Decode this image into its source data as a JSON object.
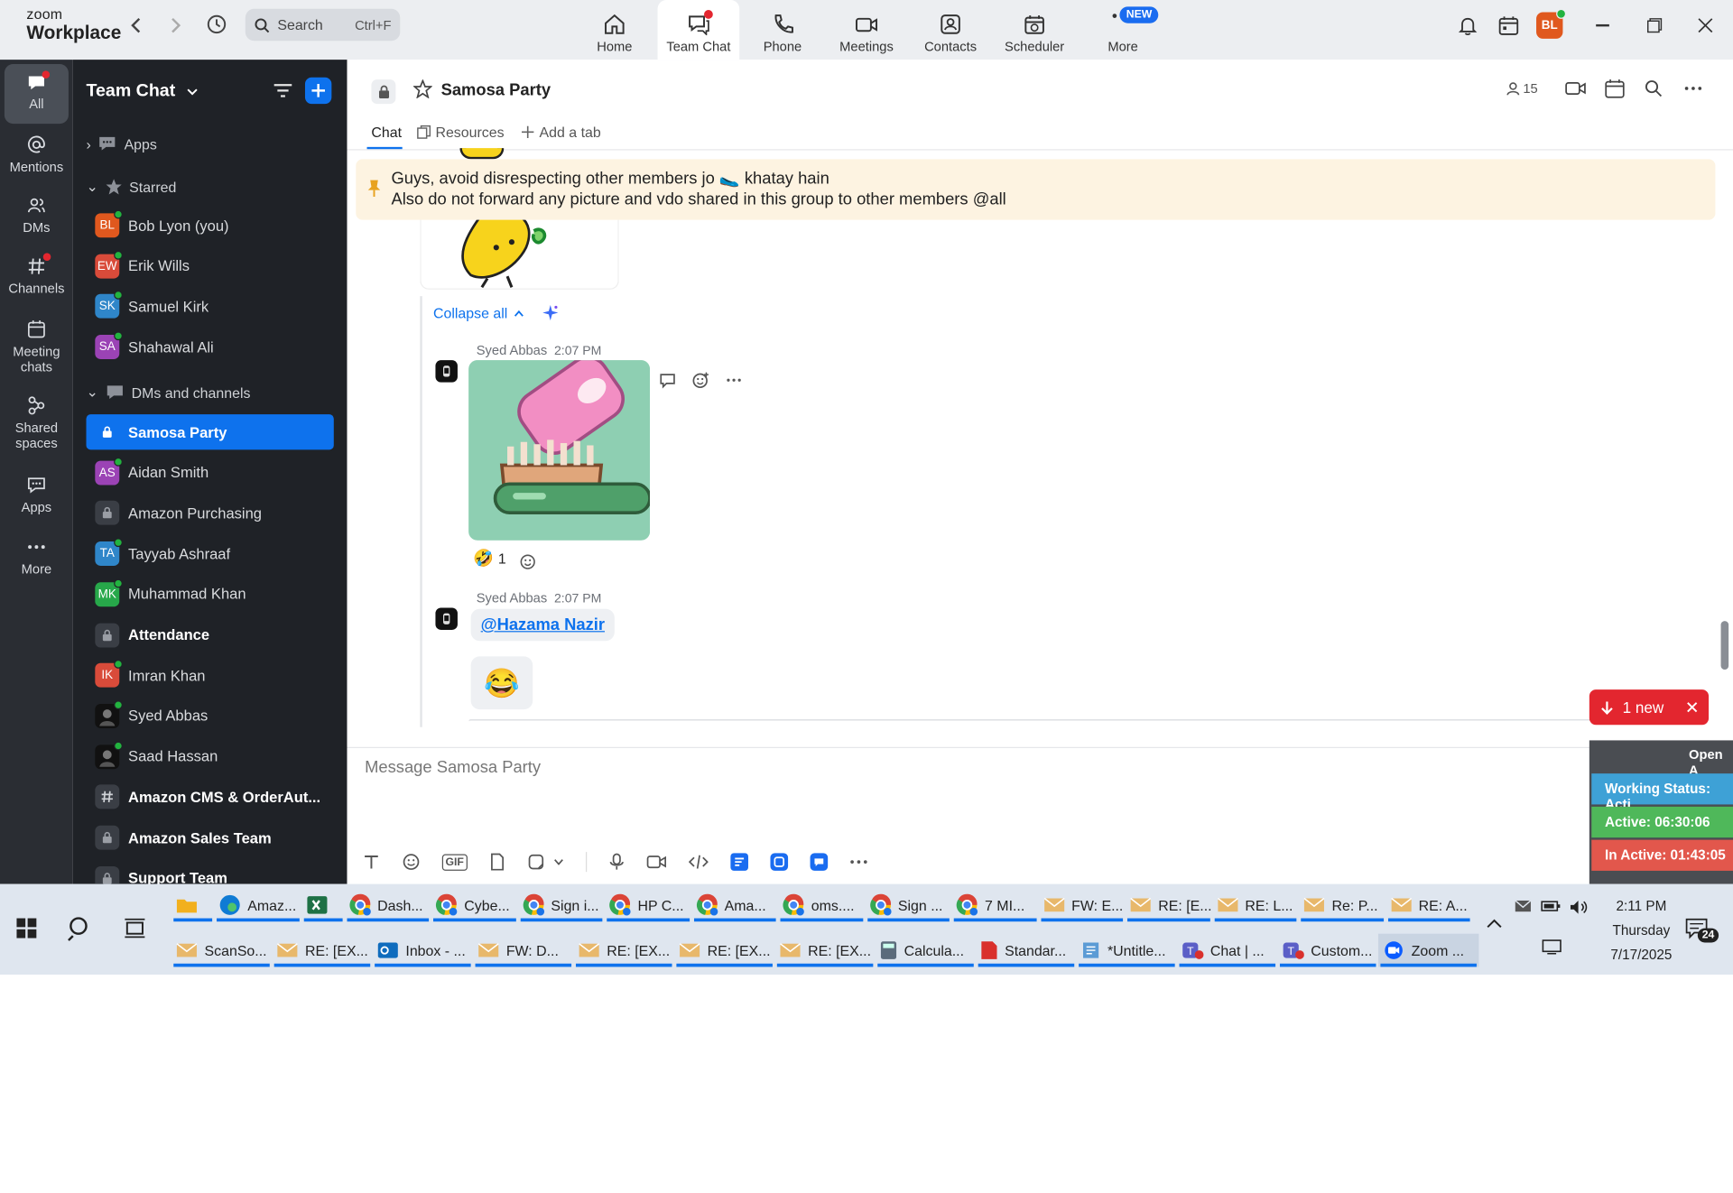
{
  "brand": {
    "line1": "zoom",
    "line2": "Workplace"
  },
  "search": {
    "placeholder": "Search",
    "shortcut": "Ctrl+F"
  },
  "top_nav": [
    {
      "label": "Home",
      "icon": "home-icon"
    },
    {
      "label": "Team Chat",
      "icon": "team-chat-icon",
      "active": true,
      "notification_dot": true
    },
    {
      "label": "Phone",
      "icon": "phone-icon"
    },
    {
      "label": "Meetings",
      "icon": "video-icon"
    },
    {
      "label": "Contacts",
      "icon": "contacts-icon"
    },
    {
      "label": "Scheduler",
      "icon": "scheduler-icon"
    },
    {
      "label": "More",
      "icon": "more-icon",
      "badge": "NEW"
    }
  ],
  "user": {
    "initials": "BL",
    "avatar_color": "#e0581e"
  },
  "rail": [
    {
      "label": "All",
      "icon": "chat-bubble-icon",
      "active": true
    },
    {
      "label": "Mentions",
      "icon": "at-icon"
    },
    {
      "label": "DMs",
      "icon": "people-icon"
    },
    {
      "label": "Channels",
      "icon": "hash-icon"
    },
    {
      "label": "Meeting chats",
      "icon": "calendar-icon"
    },
    {
      "label": "Shared spaces",
      "icon": "shared-icon"
    },
    {
      "label": "Apps",
      "icon": "apps-icon"
    },
    {
      "label": "More",
      "icon": "more-dots-icon"
    }
  ],
  "sidebar": {
    "title": "Team Chat",
    "apps_label": "Apps",
    "starred_label": "Starred",
    "starred": [
      {
        "name": "Bob Lyon (you)",
        "initials": "BL",
        "color": "#e0581e"
      },
      {
        "name": "Erik Wills",
        "initials": "EW",
        "color": "#d94b3a"
      },
      {
        "name": "Samuel Kirk",
        "initials": "SK",
        "color": "#2f86c9"
      },
      {
        "name": "Shahawal Ali",
        "initials": "SA",
        "color": "#9b43b5"
      }
    ],
    "dms_label": "DMs and channels",
    "dms": [
      {
        "name": "Samosa Party",
        "type": "lock",
        "active": true
      },
      {
        "name": "Aidan Smith",
        "type": "avatar",
        "initials": "AS",
        "color": "#9b43b5"
      },
      {
        "name": "Amazon Purchasing",
        "type": "lock"
      },
      {
        "name": "Tayyab Ashraaf",
        "type": "avatar",
        "initials": "TA",
        "color": "#2f86c9"
      },
      {
        "name": "Muhammad Khan",
        "type": "avatar",
        "initials": "MK",
        "color": "#27a84a"
      },
      {
        "name": "Attendance",
        "type": "lock",
        "bold": true
      },
      {
        "name": "Imran Khan",
        "type": "avatar",
        "initials": "IK",
        "color": "#d94b3a"
      },
      {
        "name": "Syed Abbas",
        "type": "photo"
      },
      {
        "name": "Saad Hassan",
        "type": "photo"
      },
      {
        "name": "Amazon CMS & OrderAut...",
        "type": "hash",
        "bold": true
      },
      {
        "name": "Amazon Sales Team",
        "type": "lock",
        "bold": true
      },
      {
        "name": "Support Team",
        "type": "lock",
        "bold": true
      }
    ]
  },
  "channel": {
    "title": "Samosa Party",
    "member_count": "15",
    "tabs": {
      "chat": "Chat",
      "resources": "Resources",
      "add": "Add a tab"
    },
    "pinned": {
      "line1": "Guys, avoid disrespecting other members jo 🥿 khatay hain",
      "line2": "Also do not forward any picture and vdo shared in this group to other members @all"
    },
    "collapse_all": "Collapse all",
    "messages": [
      {
        "sender": "Syed Abbas",
        "time": "2:07 PM",
        "reaction_emoji": "🤣",
        "reaction_count": "1"
      },
      {
        "sender": "Syed Abbas",
        "time": "2:07 PM",
        "mention": "@Hazama Nazir",
        "emoji": "😂"
      }
    ],
    "new_messages": "1 new",
    "composer_placeholder": "Message Samosa Party"
  },
  "overlay": {
    "open_label": "Open A",
    "working_status": "Working Status: Acti",
    "active": "Active: 06:30:06",
    "inactive": "In Active: 01:43:05"
  },
  "taskbar": {
    "row1": [
      {
        "label": "",
        "icon": "folder-icon",
        "color": "#f2b01e"
      },
      {
        "label": "Amaz...",
        "icon": "edge-icon",
        "color": "#0f7bd4"
      },
      {
        "label": "",
        "icon": "excel-icon",
        "color": "#1e7145"
      },
      {
        "label": "Dash...",
        "icon": "chrome-icon",
        "color": "#db4437"
      },
      {
        "label": "Cybe...",
        "icon": "chrome-icon",
        "color": "#db4437"
      },
      {
        "label": "Sign i...",
        "icon": "chrome-icon",
        "color": "#db4437"
      },
      {
        "label": "HP C...",
        "icon": "chrome-icon",
        "color": "#db4437"
      },
      {
        "label": "Ama...",
        "icon": "chrome-icon",
        "color": "#db4437"
      },
      {
        "label": "oms....",
        "icon": "chrome-icon",
        "color": "#db4437"
      },
      {
        "label": "Sign ...",
        "icon": "chrome-icon",
        "color": "#db4437"
      },
      {
        "label": "7 MI...",
        "icon": "chrome-icon",
        "color": "#db4437"
      },
      {
        "label": "FW: E...",
        "icon": "mail-icon",
        "color": "#e8b86b"
      },
      {
        "label": "RE: [E...",
        "icon": "mail-icon",
        "color": "#e8b86b"
      },
      {
        "label": "RE: L...",
        "icon": "mail-icon",
        "color": "#e8b86b"
      },
      {
        "label": "Re: P...",
        "icon": "mail-icon",
        "color": "#e8b86b"
      },
      {
        "label": "RE: A...",
        "icon": "mail-icon",
        "color": "#e8b86b"
      }
    ],
    "row2": [
      {
        "label": "ScanSo...",
        "icon": "mail-icon",
        "color": "#e8b86b"
      },
      {
        "label": "RE: [EX...",
        "icon": "mail-icon",
        "color": "#e8b86b"
      },
      {
        "label": "Inbox - ...",
        "icon": "outlook-icon",
        "color": "#0f6cbd"
      },
      {
        "label": "FW: D...",
        "icon": "mail-icon",
        "color": "#e8b86b"
      },
      {
        "label": "RE: [EX...",
        "icon": "mail-icon",
        "color": "#e8b86b"
      },
      {
        "label": "RE: [EX...",
        "icon": "mail-icon",
        "color": "#e8b86b"
      },
      {
        "label": "RE: [EX...",
        "icon": "mail-icon",
        "color": "#e8b86b"
      },
      {
        "label": "Calcula...",
        "icon": "calculator-icon",
        "color": "#5b6b7b"
      },
      {
        "label": "Standar...",
        "icon": "pdf-icon",
        "color": "#d9302c"
      },
      {
        "label": "*Untitle...",
        "icon": "notepad-icon",
        "color": "#5b9bd5"
      },
      {
        "label": "Chat | ...",
        "icon": "teams-icon",
        "color": "#5b5fc7"
      },
      {
        "label": "Custom...",
        "icon": "teams-icon",
        "color": "#5b5fc7"
      },
      {
        "label": "Zoom ...",
        "icon": "zoom-icon",
        "color": "#0b5cff",
        "active": true
      }
    ],
    "clock": {
      "time": "2:11 PM",
      "day": "Thursday",
      "date": "7/17/2025"
    },
    "notifications": "24"
  }
}
